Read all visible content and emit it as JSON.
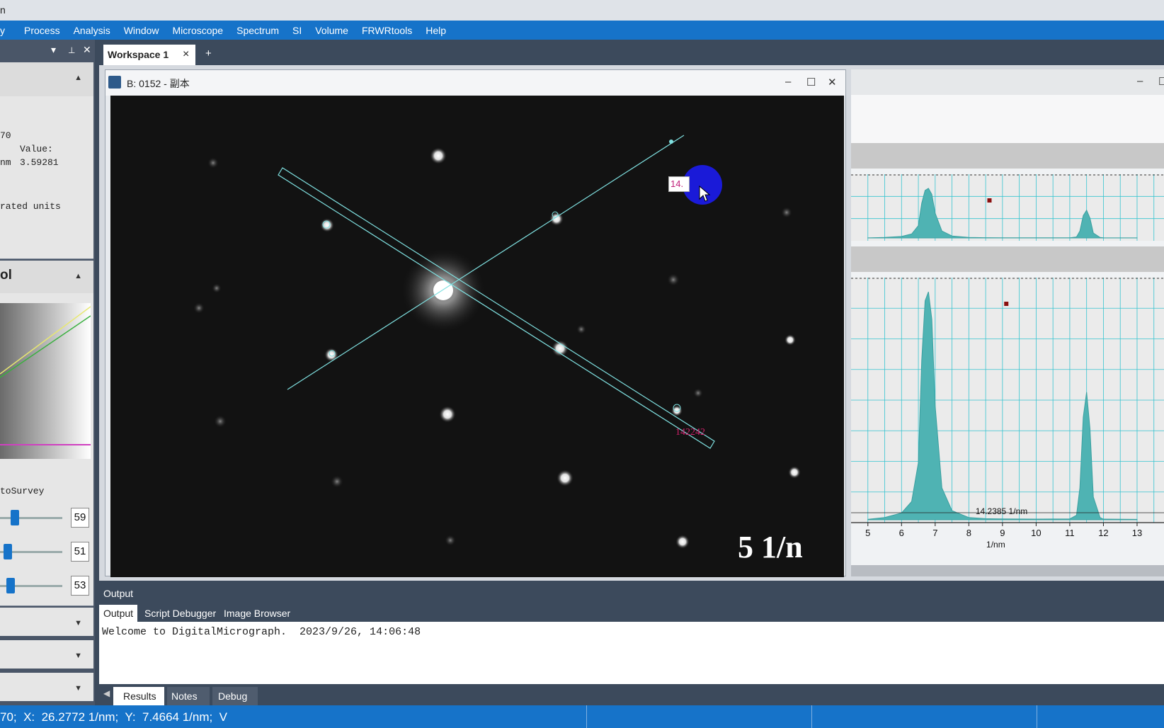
{
  "app": {
    "title_fragment": "n"
  },
  "menu": [
    "y",
    "Process",
    "Analysis",
    "Window",
    "Microscope",
    "Spectrum",
    "SI",
    "Volume",
    "FRWRtools",
    "Help"
  ],
  "left_panel": {
    "info": {
      "line1": "70",
      "value_label": "Value:",
      "line3_unit": "nm",
      "value": "3.59281",
      "units_text": "rated units"
    },
    "control": {
      "title": "ol",
      "survey_label": "toSurvey",
      "sliders": [
        {
          "value": "59",
          "level": 0.24
        },
        {
          "value": "51",
          "level": 0.13
        },
        {
          "value": "53",
          "level": 0.17
        }
      ]
    }
  },
  "workspace": {
    "tab_label": "Workspace 1",
    "close": "×",
    "add": "+"
  },
  "image_window": {
    "title": "B: 0152 - 副本",
    "edit_value": "14.",
    "intensity_label": "142242",
    "scale_text": "5 1/n"
  },
  "spectrum": {
    "xlabel": "1/nm",
    "ticks": [
      "5",
      "6",
      "7",
      "8",
      "9",
      "10",
      "11",
      "12",
      "13"
    ],
    "measure_label": "14.2385 1/nm",
    "chart_data": {
      "type": "area",
      "x": [
        5,
        5.5,
        6,
        6.3,
        6.5,
        6.6,
        6.7,
        6.8,
        6.9,
        7.0,
        7.2,
        7.5,
        8,
        8.5,
        9,
        10,
        11,
        11.2,
        11.3,
        11.4,
        11.5,
        11.6,
        11.7,
        11.9,
        12,
        13
      ],
      "series": [
        {
          "values": [
            0.2,
            1,
            3,
            8,
            25,
            70,
            96,
            100,
            88,
            50,
            14,
            4,
            1,
            0.5,
            0.4,
            0.3,
            0.4,
            2,
            14,
            45,
            56,
            40,
            10,
            1,
            0.3,
            0.2
          ]
        }
      ],
      "xlim": [
        4.5,
        13.8
      ],
      "grid": true
    }
  },
  "output": {
    "header": "Output",
    "tabs": [
      "Output",
      "Script Debugger",
      "Image Browser"
    ],
    "text": "Welcome to DigitalMicrograph.  2023/9/26, 14:06:48",
    "bottom_tabs": [
      "Results",
      "Notes",
      "Debug"
    ]
  },
  "status": {
    "text": "70;  X:  26.2772 1/nm;  Y:  7.4664 1/nm;  V"
  }
}
